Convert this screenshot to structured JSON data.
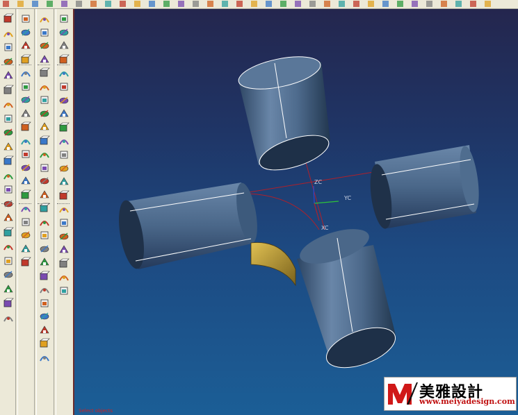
{
  "axis_labels": {
    "zc": "ZC",
    "yc": "YC",
    "xc": "XC"
  },
  "status": {
    "text": "Select objects"
  },
  "watermark": {
    "brand_cn": "美雅設計",
    "url": "www.meiyadesign.com",
    "mark": "M"
  },
  "colors": {
    "cylinder": "#4f6d8f",
    "patch": "#c9a83c",
    "ref_line": "#b0202a",
    "y_axis": "#2ec43a",
    "z_axis": "#2a4ad0"
  },
  "toolbar_icons": [
    "sketch-icon",
    "curve-icon",
    "extrude-icon",
    "revolve-icon",
    "sweep-icon",
    "swept-icon",
    "tube-icon",
    "pad-icon",
    "boss-icon",
    "pocket-icon",
    "hole-icon",
    "chamfer-icon",
    "blend-icon",
    "shell-icon",
    "thread-icon",
    "pattern-icon",
    "mirror-icon",
    "trim-icon",
    "split-icon",
    "offset-icon",
    "sew-icon",
    "patch-icon",
    "thicken-icon",
    "scale-icon",
    "block-icon",
    "cylinder-icon",
    "cone-icon",
    "sphere-icon",
    "unite-icon",
    "subtract-icon",
    "intersect-icon",
    "edit-icon"
  ]
}
